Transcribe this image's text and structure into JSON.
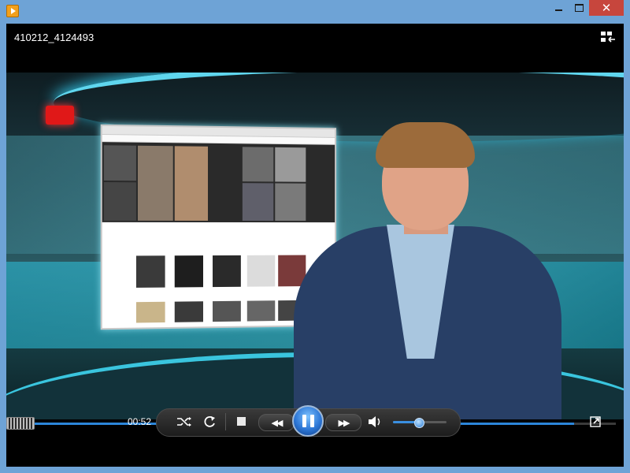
{
  "window": {
    "title": "410212_4124493"
  },
  "playback": {
    "time": "00:52",
    "progress_fraction": 0.93,
    "volume_fraction": 0.48,
    "state": "playing"
  },
  "icons": {
    "app": "media-player-icon",
    "minimize": "minimize-icon",
    "maximize": "maximize-icon",
    "close": "close-icon",
    "switch_view": "switch-to-library-icon",
    "mode": "visualization-mode-icon",
    "shuffle": "shuffle-icon",
    "repeat": "repeat-icon",
    "stop": "stop-icon",
    "previous": "previous-icon",
    "pause": "pause-icon",
    "next": "next-icon",
    "volume": "speaker-icon",
    "fullscreen": "fullscreen-icon"
  },
  "colors": {
    "window_frame": "#6ea3d6",
    "close_button": "#c7463d",
    "accent": "#2c86d9"
  }
}
